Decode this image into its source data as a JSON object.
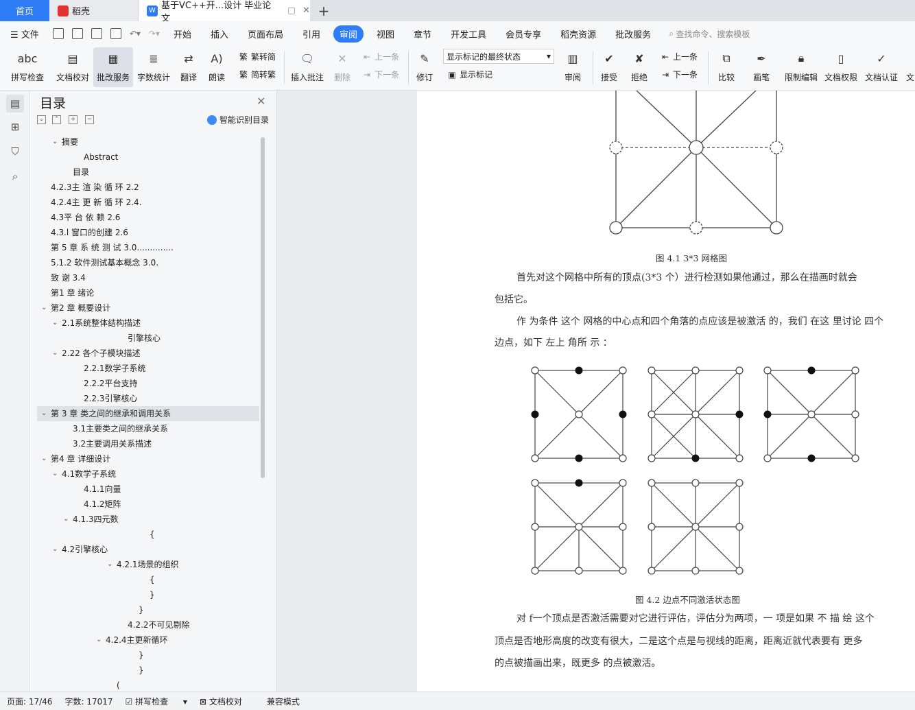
{
  "tabs": {
    "home": "首页",
    "daoke": "稻壳",
    "doc": "基于VC++开...设计 毕业论文"
  },
  "menu": {
    "file": "文件",
    "items": [
      "开始",
      "插入",
      "页面布局",
      "引用",
      "审阅",
      "视图",
      "章节",
      "开发工具",
      "会员专享",
      "稻壳资源",
      "批改服务"
    ],
    "search": "查找命令、搜索模板"
  },
  "ribbon": {
    "spell": "拼写检查",
    "proofread": "文档校对",
    "correction": "批改服务",
    "wordcount": "字数统计",
    "translate": "翻译",
    "readaloud": "朗读",
    "to_trad": "繁转简",
    "to_simp": "简转繁",
    "insert_comment": "插入批注",
    "delete": "删除",
    "prev": "上一条",
    "next": "下一条",
    "revise": "修订",
    "markup_state": "显示标记的最终状态",
    "show_markup": "显示标记",
    "review": "审阅",
    "accept": "接受",
    "reject": "拒绝",
    "prev2": "上一条",
    "next2": "下一条",
    "compare": "比较",
    "pen": "画笔",
    "restrict": "限制编辑",
    "permission": "文档权限",
    "certify": "文档认证",
    "more": "文"
  },
  "toc": {
    "title": "目录",
    "smart": "智能识别目录",
    "items": [
      {
        "label": "摘要",
        "indent": 1,
        "chev": true
      },
      {
        "label": "Abstract",
        "indent": 3
      },
      {
        "label": "目录",
        "indent": 2
      },
      {
        "label": "4.2.3主 渲 染 循 环 2.2",
        "indent": 0
      },
      {
        "label": "4.2.4主 更 新 循 环 2.4.",
        "indent": 0
      },
      {
        "label": "4.3平 台 依 赖 2.6",
        "indent": 0
      },
      {
        "label": "4.3.l  窗口的创建 2.6",
        "indent": 0
      },
      {
        "label": "第 5  章 系 统 测 试 3.0..............",
        "indent": 0
      },
      {
        "label": "5.1.2    软件测试基本概念 3.0.",
        "indent": 0
      },
      {
        "label": "致 谢 3.4",
        "indent": 0
      },
      {
        "label": "第1 章 绪论",
        "indent": 0
      },
      {
        "label": "第2 章 概要设计",
        "indent": 0,
        "chev": true
      },
      {
        "label": "2.1系统整体结构描述",
        "indent": 1,
        "chev": true
      },
      {
        "label": "引擎核心",
        "indent": 7
      },
      {
        "label": "2.22 各个子模块描述",
        "indent": 1,
        "chev": true
      },
      {
        "label": "2.2.1数学子系统",
        "indent": 3
      },
      {
        "label": "2.2.2平台支持",
        "indent": 3
      },
      {
        "label": "2.2.3引擎核心",
        "indent": 3
      },
      {
        "label": "第 3 章 类之间的继承和调用关系",
        "indent": 0,
        "chev": true,
        "sel": true
      },
      {
        "label": "3.1主要类之间的继承关系",
        "indent": 2
      },
      {
        "label": "3.2主要调用关系描述",
        "indent": 2
      },
      {
        "label": "第4 章 详细设计",
        "indent": 0,
        "chev": true
      },
      {
        "label": "4.1数学子系统",
        "indent": 1,
        "chev": true
      },
      {
        "label": "4.1.1向量",
        "indent": 3
      },
      {
        "label": "4.1.2矩阵",
        "indent": 3
      },
      {
        "label": "4.1.3四元数",
        "indent": 2,
        "chev": true
      },
      {
        "label": "{",
        "indent": 9
      },
      {
        "label": "4.2引擎核心",
        "indent": 1,
        "chev": true
      },
      {
        "label": "4.2.1场景的组织",
        "indent": 6,
        "chev": true
      },
      {
        "label": "{",
        "indent": 9
      },
      {
        "label": "}",
        "indent": 9
      },
      {
        "label": "}",
        "indent": 8
      },
      {
        "label": "4.2.2不可见剔除",
        "indent": 7
      },
      {
        "label": "4.2.4主更新循环",
        "indent": 5,
        "chev": true
      },
      {
        "label": "}",
        "indent": 8
      },
      {
        "label": "}",
        "indent": 8
      },
      {
        "label": "(",
        "indent": 6
      }
    ]
  },
  "doc": {
    "fig1_caption": "图 4.1   3*3 网格图",
    "para1_line1": "首先对这个网格中所有的顶点(3*3  个）进行检测如果他通过，那么在描画时就会",
    "para1_line2": "包括它。",
    "para2_line1": "作 为条件 这个 网格的中心点和四个角落的点应该是被激活  的，我们 在这  里讨论 四个",
    "para2_line2": "边点，如下 左上  角所  示 ：",
    "fig2_caption": "图 4.2 边点不同激活状态图",
    "para3_line1": "对  f一个顶点是否激活需要对它进行评估，评估分为两项，一 项是如果   不  描 绘 这个",
    "para3_line2": "顶点是否地形高度的改变有很大，二是这个点是与视线的距离，距离近就代表要有         更多",
    "para3_line3": "的点被描画出来，既更多 的点被激活。"
  },
  "status": {
    "page": "页面: 17/46",
    "words": "字数: 17017",
    "spell": "拼写检查",
    "proof": "文档校对",
    "compat": "兼容模式"
  },
  "colors": {
    "accent": "#2e7cf6",
    "daoke_red": "#e0322f",
    "wps_blue": "#2e7cf6"
  }
}
